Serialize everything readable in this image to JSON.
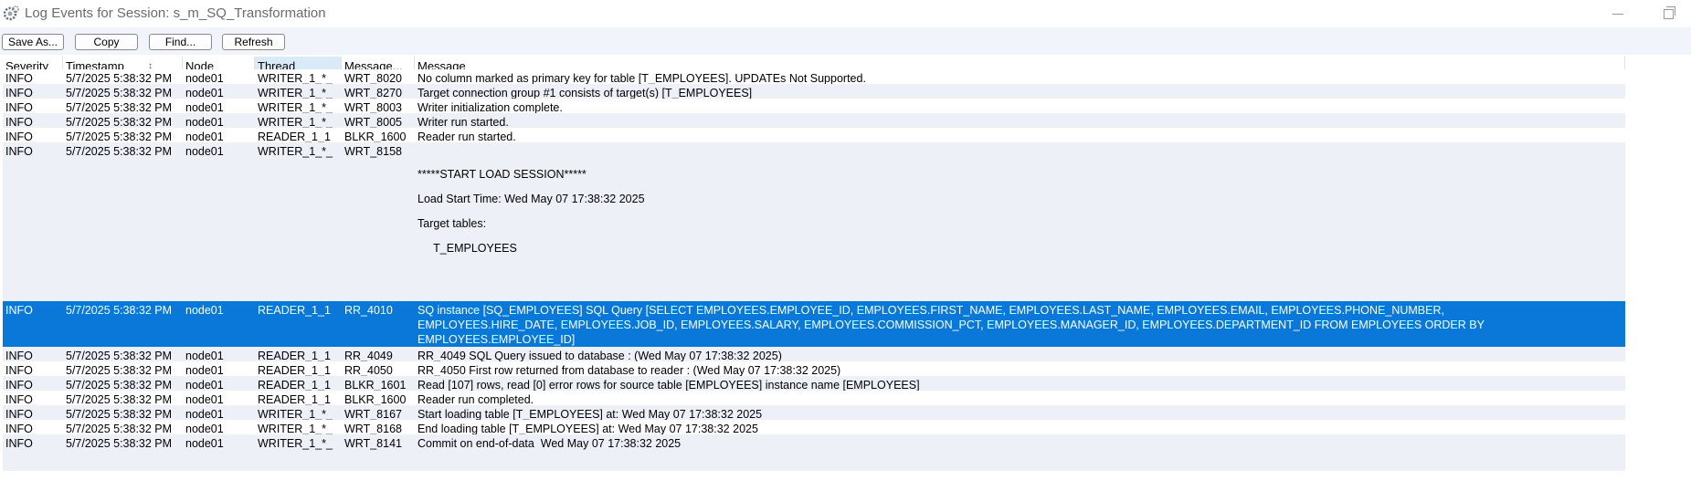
{
  "window": {
    "title": "Log Events for Session: s_m_SQ_Transformation"
  },
  "toolbar": {
    "buttons": [
      "Save As...",
      "Copy",
      "Find...",
      "Refresh"
    ]
  },
  "columns": [
    {
      "label": "Severity"
    },
    {
      "label": "Timestamp",
      "sorted": true
    },
    {
      "label": "Node"
    },
    {
      "label": "Thread",
      "highlighted": true
    },
    {
      "label": "Message..."
    },
    {
      "label": "Message"
    }
  ],
  "sort_indicator": "↕",
  "rows": [
    {
      "severity": "INFO",
      "timestamp": "5/7/2025 5:38:32 PM",
      "node": "node01",
      "thread": "WRITER_1_*_",
      "code": "WRT_8020",
      "message": [
        "No column marked as primary key for table [T_EMPLOYEES]. UPDATEs Not Supported."
      ]
    },
    {
      "severity": "INFO",
      "timestamp": "5/7/2025 5:38:32 PM",
      "node": "node01",
      "thread": "WRITER_1_*_",
      "code": "WRT_8270",
      "message": [
        "Target connection group #1 consists of target(s) [T_EMPLOYEES]"
      ]
    },
    {
      "severity": "INFO",
      "timestamp": "5/7/2025 5:38:32 PM",
      "node": "node01",
      "thread": "WRITER_1_*_",
      "code": "WRT_8003",
      "message": [
        "Writer initialization complete."
      ]
    },
    {
      "severity": "INFO",
      "timestamp": "5/7/2025 5:38:32 PM",
      "node": "node01",
      "thread": "WRITER_1_*_",
      "code": "WRT_8005",
      "message": [
        "Writer run started."
      ]
    },
    {
      "severity": "INFO",
      "timestamp": "5/7/2025 5:38:32 PM",
      "node": "node01",
      "thread": "READER_1_1",
      "code": "BLKR_1600",
      "message": [
        "Reader run started."
      ]
    },
    {
      "severity": "INFO",
      "timestamp": "5/7/2025 5:38:32 PM",
      "node": "node01",
      "thread": "WRITER_1_*_",
      "code": "WRT_8158",
      "message": [
        "",
        "",
        "*****START LOAD SESSION*****",
        "",
        "Load Start Time: Wed May 07 17:38:32 2025",
        "",
        "Target tables:",
        "",
        "     T_EMPLOYEES",
        "",
        ""
      ]
    },
    {
      "severity": "INFO",
      "timestamp": "5/7/2025 5:38:32 PM",
      "node": "node01",
      "thread": "READER_1_1",
      "code": "RR_4010",
      "selected": true,
      "message": [
        "SQ instance [SQ_EMPLOYEES] SQL Query [SELECT EMPLOYEES.EMPLOYEE_ID, EMPLOYEES.FIRST_NAME, EMPLOYEES.LAST_NAME, EMPLOYEES.EMAIL, EMPLOYEES.PHONE_NUMBER,",
        "EMPLOYEES.HIRE_DATE, EMPLOYEES.JOB_ID, EMPLOYEES.SALARY, EMPLOYEES.COMMISSION_PCT, EMPLOYEES.MANAGER_ID, EMPLOYEES.DEPARTMENT_ID FROM EMPLOYEES ORDER BY",
        "EMPLOYEES.EMPLOYEE_ID]"
      ]
    },
    {
      "severity": "INFO",
      "timestamp": "5/7/2025 5:38:32 PM",
      "node": "node01",
      "thread": "READER_1_1",
      "code": "RR_4049",
      "message": [
        "RR_4049 SQL Query issued to database : (Wed May 07 17:38:32 2025)"
      ]
    },
    {
      "severity": "INFO",
      "timestamp": "5/7/2025 5:38:32 PM",
      "node": "node01",
      "thread": "READER_1_1",
      "code": "RR_4050",
      "message": [
        "RR_4050 First row returned from database to reader : (Wed May 07 17:38:32 2025)"
      ]
    },
    {
      "severity": "INFO",
      "timestamp": "5/7/2025 5:38:32 PM",
      "node": "node01",
      "thread": "READER_1_1",
      "code": "BLKR_1601",
      "message": [
        "Read [107] rows, read [0] error rows for source table [EMPLOYEES] instance name [EMPLOYEES]"
      ]
    },
    {
      "severity": "INFO",
      "timestamp": "5/7/2025 5:38:32 PM",
      "node": "node01",
      "thread": "READER_1_1",
      "code": "BLKR_1600",
      "message": [
        "Reader run completed."
      ]
    },
    {
      "severity": "INFO",
      "timestamp": "5/7/2025 5:38:32 PM",
      "node": "node01",
      "thread": "WRITER_1_*_",
      "code": "WRT_8167",
      "message": [
        "Start loading table [T_EMPLOYEES] at: Wed May 07 17:38:32 2025"
      ]
    },
    {
      "severity": "INFO",
      "timestamp": "5/7/2025 5:38:32 PM",
      "node": "node01",
      "thread": "WRITER_1_*_",
      "code": "WRT_8168",
      "message": [
        "End loading table [T_EMPLOYEES] at: Wed May 07 17:38:32 2025"
      ]
    },
    {
      "severity": "INFO",
      "timestamp": "5/7/2025 5:38:32 PM",
      "node": "node01",
      "thread": "WRITER_1_*_",
      "code": "WRT_8141",
      "message": [
        "",
        "Commit on end-of-data  Wed May 07 17:38:32 2025"
      ]
    }
  ],
  "colors": {
    "selection": "#0a78d8",
    "alt_row": "#eef0f8",
    "toolbar_bg": "#f1f5fb",
    "header_highlight": "#d9ebf9"
  }
}
